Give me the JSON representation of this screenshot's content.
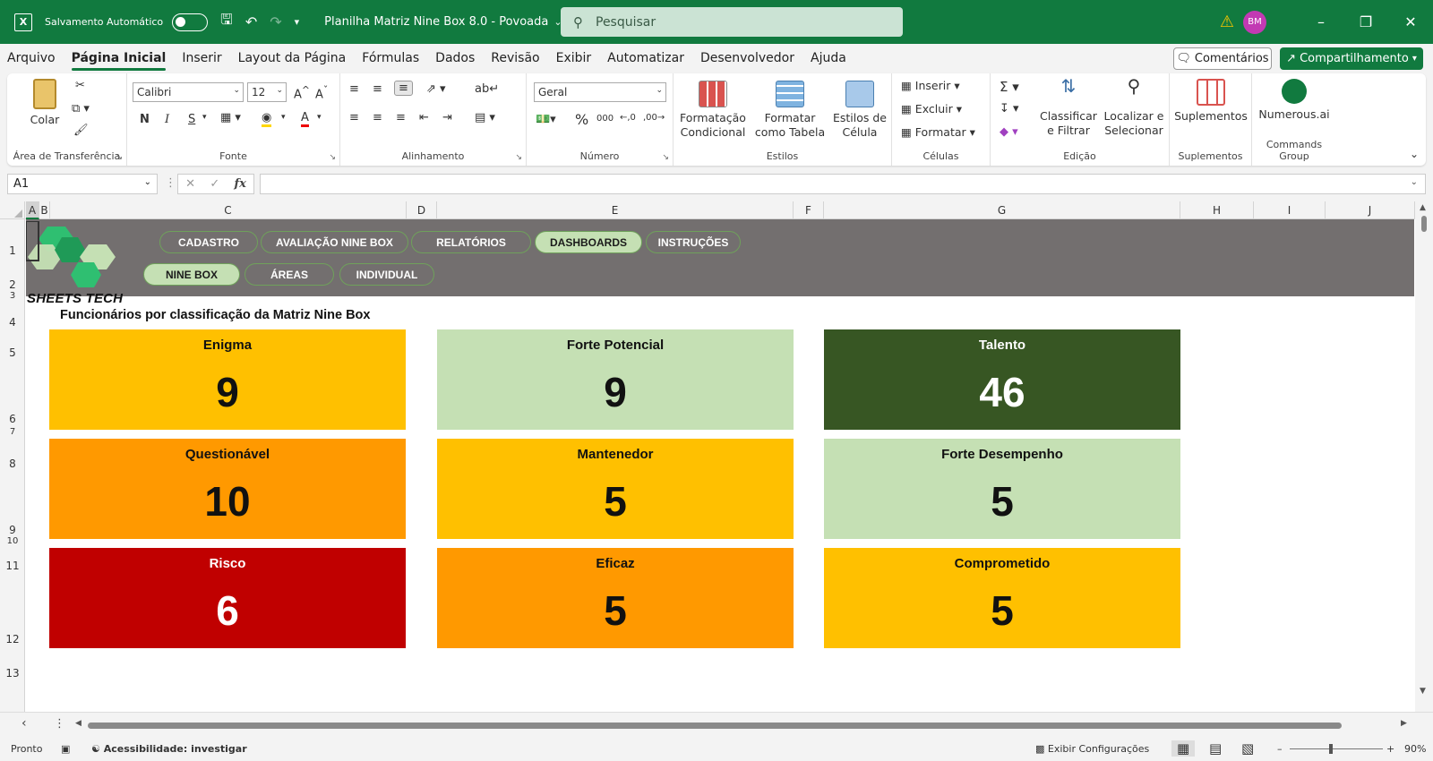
{
  "titlebar": {
    "autosave_label": "Salvamento Automático",
    "file_name": "Planilha Matriz Nine Box 8.0 - Povoada",
    "search_placeholder": "Pesquisar",
    "user_initials": "BM"
  },
  "menu": {
    "tabs": [
      "Arquivo",
      "Página Inicial",
      "Inserir",
      "Layout da Página",
      "Fórmulas",
      "Dados",
      "Revisão",
      "Exibir",
      "Automatizar",
      "Desenvolvedor",
      "Ajuda"
    ],
    "active_tab": "Página Inicial",
    "comments_label": "Comentários",
    "share_label": "Compartilhamento"
  },
  "ribbon": {
    "clipboard": {
      "paste_label": "Colar",
      "group_label": "Área de Transferência"
    },
    "font": {
      "font_name": "Calibri",
      "font_size": "12",
      "bold": "N",
      "italic": "I",
      "underline": "S",
      "group_label": "Fonte"
    },
    "alignment": {
      "group_label": "Alinhamento"
    },
    "number": {
      "format": "Geral",
      "group_label": "Número"
    },
    "styles": {
      "conditional": "Formatação Condicional",
      "as_table": "Formatar como Tabela",
      "cell_styles": "Estilos de Célula",
      "group_label": "Estilos"
    },
    "cells": {
      "insert": "Inserir",
      "delete": "Excluir",
      "format": "Formatar",
      "group_label": "Células"
    },
    "editing": {
      "sort": "Classificar e Filtrar",
      "find": "Localizar e Selecionar",
      "group_label": "Edição"
    },
    "addins": {
      "label": "Suplementos",
      "group_label": "Suplementos"
    },
    "numerous": {
      "label": "Numerous.ai",
      "group_label": "Commands Group"
    }
  },
  "formula_bar": {
    "cell_ref": "A1",
    "formula": ""
  },
  "columns": [
    "A",
    "B",
    "C",
    "D",
    "E",
    "F",
    "G",
    "H",
    "I",
    "J"
  ],
  "rows": [
    "1",
    "2",
    "3",
    "4",
    "5",
    "6",
    "7",
    "8",
    "9",
    "10",
    "11",
    "12",
    "13"
  ],
  "dashboard": {
    "nav_top": [
      "CADASTRO",
      "AVALIAÇÃO NINE BOX",
      "RELATÓRIOS",
      "DASHBOARDS",
      "INSTRUÇÕES"
    ],
    "nav_sub": [
      "NINE BOX",
      "ÁREAS",
      "INDIVIDUAL"
    ],
    "active_top": "DASHBOARDS",
    "active_sub": "NINE BOX",
    "logo_text": "SHEETS TECH",
    "title": "Funcionários por classificação da Matriz Nine Box",
    "boxes": [
      {
        "label": "Enigma",
        "value": "9",
        "bg": "#ffc000",
        "fg": "#111111"
      },
      {
        "label": "Forte Potencial",
        "value": "9",
        "bg": "#c5e0b4",
        "fg": "#111111"
      },
      {
        "label": "Talento",
        "value": "46",
        "bg": "#375623",
        "fg": "#ffffff"
      },
      {
        "label": "Questionável",
        "value": "10",
        "bg": "#ff9900",
        "fg": "#111111"
      },
      {
        "label": "Mantenedor",
        "value": "5",
        "bg": "#ffc000",
        "fg": "#111111"
      },
      {
        "label": "Forte Desempenho",
        "value": "5",
        "bg": "#c5e0b4",
        "fg": "#111111"
      },
      {
        "label": "Risco",
        "value": "6",
        "bg": "#c00000",
        "fg": "#ffffff"
      },
      {
        "label": "Eficaz",
        "value": "5",
        "bg": "#ff9900",
        "fg": "#111111"
      },
      {
        "label": "Comprometido",
        "value": "5",
        "bg": "#ffc000",
        "fg": "#111111"
      }
    ]
  },
  "statusbar": {
    "ready": "Pronto",
    "accessibility": "Acessibilidade: investigar",
    "display_settings": "Exibir Configurações",
    "zoom": "90%"
  },
  "colors": {
    "excel_green": "#117a3f",
    "banner_gray": "#736f6f",
    "pill_active": "#c5e0b4"
  }
}
